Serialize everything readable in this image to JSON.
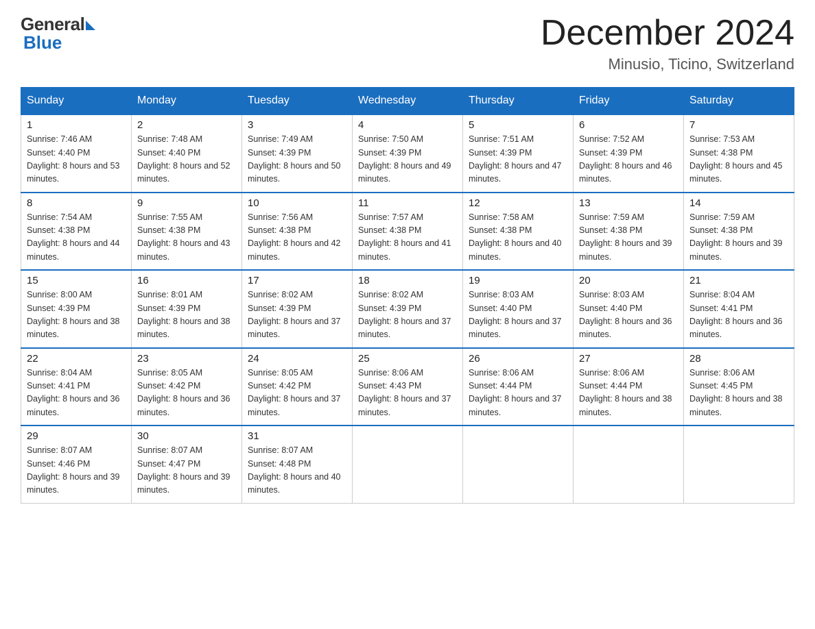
{
  "logo": {
    "general": "General",
    "blue": "Blue"
  },
  "title": "December 2024",
  "location": "Minusio, Ticino, Switzerland",
  "weekdays": [
    "Sunday",
    "Monday",
    "Tuesday",
    "Wednesday",
    "Thursday",
    "Friday",
    "Saturday"
  ],
  "weeks": [
    [
      {
        "day": "1",
        "sunrise": "7:46 AM",
        "sunset": "4:40 PM",
        "daylight": "8 hours and 53 minutes."
      },
      {
        "day": "2",
        "sunrise": "7:48 AM",
        "sunset": "4:40 PM",
        "daylight": "8 hours and 52 minutes."
      },
      {
        "day": "3",
        "sunrise": "7:49 AM",
        "sunset": "4:39 PM",
        "daylight": "8 hours and 50 minutes."
      },
      {
        "day": "4",
        "sunrise": "7:50 AM",
        "sunset": "4:39 PM",
        "daylight": "8 hours and 49 minutes."
      },
      {
        "day": "5",
        "sunrise": "7:51 AM",
        "sunset": "4:39 PM",
        "daylight": "8 hours and 47 minutes."
      },
      {
        "day": "6",
        "sunrise": "7:52 AM",
        "sunset": "4:39 PM",
        "daylight": "8 hours and 46 minutes."
      },
      {
        "day": "7",
        "sunrise": "7:53 AM",
        "sunset": "4:38 PM",
        "daylight": "8 hours and 45 minutes."
      }
    ],
    [
      {
        "day": "8",
        "sunrise": "7:54 AM",
        "sunset": "4:38 PM",
        "daylight": "8 hours and 44 minutes."
      },
      {
        "day": "9",
        "sunrise": "7:55 AM",
        "sunset": "4:38 PM",
        "daylight": "8 hours and 43 minutes."
      },
      {
        "day": "10",
        "sunrise": "7:56 AM",
        "sunset": "4:38 PM",
        "daylight": "8 hours and 42 minutes."
      },
      {
        "day": "11",
        "sunrise": "7:57 AM",
        "sunset": "4:38 PM",
        "daylight": "8 hours and 41 minutes."
      },
      {
        "day": "12",
        "sunrise": "7:58 AM",
        "sunset": "4:38 PM",
        "daylight": "8 hours and 40 minutes."
      },
      {
        "day": "13",
        "sunrise": "7:59 AM",
        "sunset": "4:38 PM",
        "daylight": "8 hours and 39 minutes."
      },
      {
        "day": "14",
        "sunrise": "7:59 AM",
        "sunset": "4:38 PM",
        "daylight": "8 hours and 39 minutes."
      }
    ],
    [
      {
        "day": "15",
        "sunrise": "8:00 AM",
        "sunset": "4:39 PM",
        "daylight": "8 hours and 38 minutes."
      },
      {
        "day": "16",
        "sunrise": "8:01 AM",
        "sunset": "4:39 PM",
        "daylight": "8 hours and 38 minutes."
      },
      {
        "day": "17",
        "sunrise": "8:02 AM",
        "sunset": "4:39 PM",
        "daylight": "8 hours and 37 minutes."
      },
      {
        "day": "18",
        "sunrise": "8:02 AM",
        "sunset": "4:39 PM",
        "daylight": "8 hours and 37 minutes."
      },
      {
        "day": "19",
        "sunrise": "8:03 AM",
        "sunset": "4:40 PM",
        "daylight": "8 hours and 37 minutes."
      },
      {
        "day": "20",
        "sunrise": "8:03 AM",
        "sunset": "4:40 PM",
        "daylight": "8 hours and 36 minutes."
      },
      {
        "day": "21",
        "sunrise": "8:04 AM",
        "sunset": "4:41 PM",
        "daylight": "8 hours and 36 minutes."
      }
    ],
    [
      {
        "day": "22",
        "sunrise": "8:04 AM",
        "sunset": "4:41 PM",
        "daylight": "8 hours and 36 minutes."
      },
      {
        "day": "23",
        "sunrise": "8:05 AM",
        "sunset": "4:42 PM",
        "daylight": "8 hours and 36 minutes."
      },
      {
        "day": "24",
        "sunrise": "8:05 AM",
        "sunset": "4:42 PM",
        "daylight": "8 hours and 37 minutes."
      },
      {
        "day": "25",
        "sunrise": "8:06 AM",
        "sunset": "4:43 PM",
        "daylight": "8 hours and 37 minutes."
      },
      {
        "day": "26",
        "sunrise": "8:06 AM",
        "sunset": "4:44 PM",
        "daylight": "8 hours and 37 minutes."
      },
      {
        "day": "27",
        "sunrise": "8:06 AM",
        "sunset": "4:44 PM",
        "daylight": "8 hours and 38 minutes."
      },
      {
        "day": "28",
        "sunrise": "8:06 AM",
        "sunset": "4:45 PM",
        "daylight": "8 hours and 38 minutes."
      }
    ],
    [
      {
        "day": "29",
        "sunrise": "8:07 AM",
        "sunset": "4:46 PM",
        "daylight": "8 hours and 39 minutes."
      },
      {
        "day": "30",
        "sunrise": "8:07 AM",
        "sunset": "4:47 PM",
        "daylight": "8 hours and 39 minutes."
      },
      {
        "day": "31",
        "sunrise": "8:07 AM",
        "sunset": "4:48 PM",
        "daylight": "8 hours and 40 minutes."
      },
      null,
      null,
      null,
      null
    ]
  ]
}
